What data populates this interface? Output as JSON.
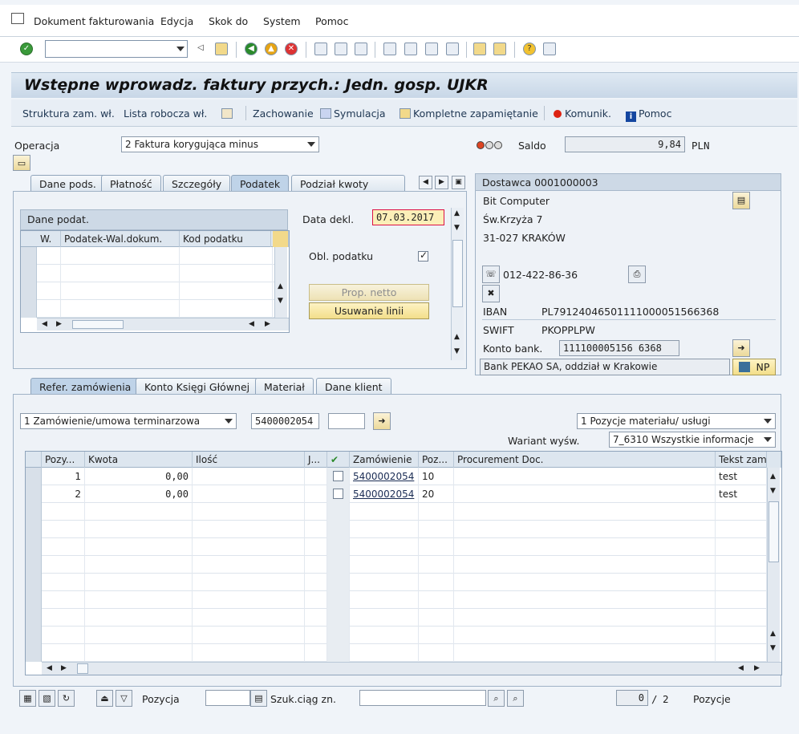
{
  "menu": {
    "items": [
      "Dokument fakturowania",
      "Edycja",
      "Skok do",
      "System",
      "Pomoc"
    ]
  },
  "title": "Wstępne wprowadz. faktury przych.: Jedn. gosp. UJKR",
  "appbar": {
    "struktura": "Struktura zam. wł.",
    "lista": "Lista robocza wł.",
    "zachowanie": "Zachowanie",
    "symulacja": "Symulacja",
    "kompletne": "Kompletne zapamiętanie",
    "komunik": "Komunik.",
    "pomoc": "Pomoc"
  },
  "header": {
    "operacja_label": "Operacja",
    "operacja_value": "2 Faktura korygująca minus",
    "saldo_label": "Saldo",
    "saldo_value": "9,84",
    "currency": "PLN"
  },
  "top_tabs": [
    "Dane pods.",
    "Płatność",
    "Szczegóły",
    "Podatek",
    "Podział kwoty"
  ],
  "tax": {
    "group_title": "Dane podat.",
    "cols": [
      "W.",
      "Podatek-Wal.dokum.",
      "Kod podatku"
    ],
    "data_dekl_label": "Data dekl.",
    "data_dekl_value": "07.03.2017",
    "obl_label": "Obl. podatku",
    "prop_netto": "Prop. netto",
    "usuwanie": "Usuwanie linii"
  },
  "vendor": {
    "header": "Dostawca 0001000003",
    "name": "Bit Computer",
    "street": "Św.Krzyża 7",
    "city": "31-027 KRAKÓW",
    "phone": "012-422-86-36",
    "iban_label": "IBAN",
    "iban_value": "PL79124046501111000051566368",
    "swift_label": "SWIFT",
    "swift_value": "PKOPPLPW",
    "konto_label": "Konto bank.",
    "konto_value": "111100005156 6368",
    "bank_name": "Bank PEKAO SA, oddział w Krakowie",
    "np": "NP"
  },
  "bottom_tabs": [
    "Refer. zamówienia",
    "Konto Księgi Głównej",
    "Materiał",
    "Dane klient"
  ],
  "ref": {
    "type_value": "1 Zamówienie/umowa terminarzowa",
    "order_number": "5400002054",
    "pozycje_select": "1 Pozycje materiału/ usługi",
    "wariant_label": "Wariant wyśw.",
    "wariant_value": "7_6310 Wszystkie informacje"
  },
  "items_table": {
    "cols": [
      "Pozy...",
      "Kwota",
      "Ilość",
      "J...",
      "",
      "Zamówienie",
      "Poz...",
      "Procurement Doc.",
      "Tekst zam"
    ],
    "rows": [
      {
        "pos": "1",
        "kwota": "0,00",
        "zam": "5400002054",
        "pozz": "10",
        "tekst": "test"
      },
      {
        "pos": "2",
        "kwota": "0,00",
        "zam": "5400002054",
        "pozz": "20",
        "tekst": "test"
      }
    ]
  },
  "footer": {
    "pozycja_label": "Pozycja",
    "szuk_label": "Szuk.ciąg zn.",
    "count_current": "0",
    "count_sep": "/",
    "count_total": "2",
    "pozycje_label": "Pozycje"
  }
}
